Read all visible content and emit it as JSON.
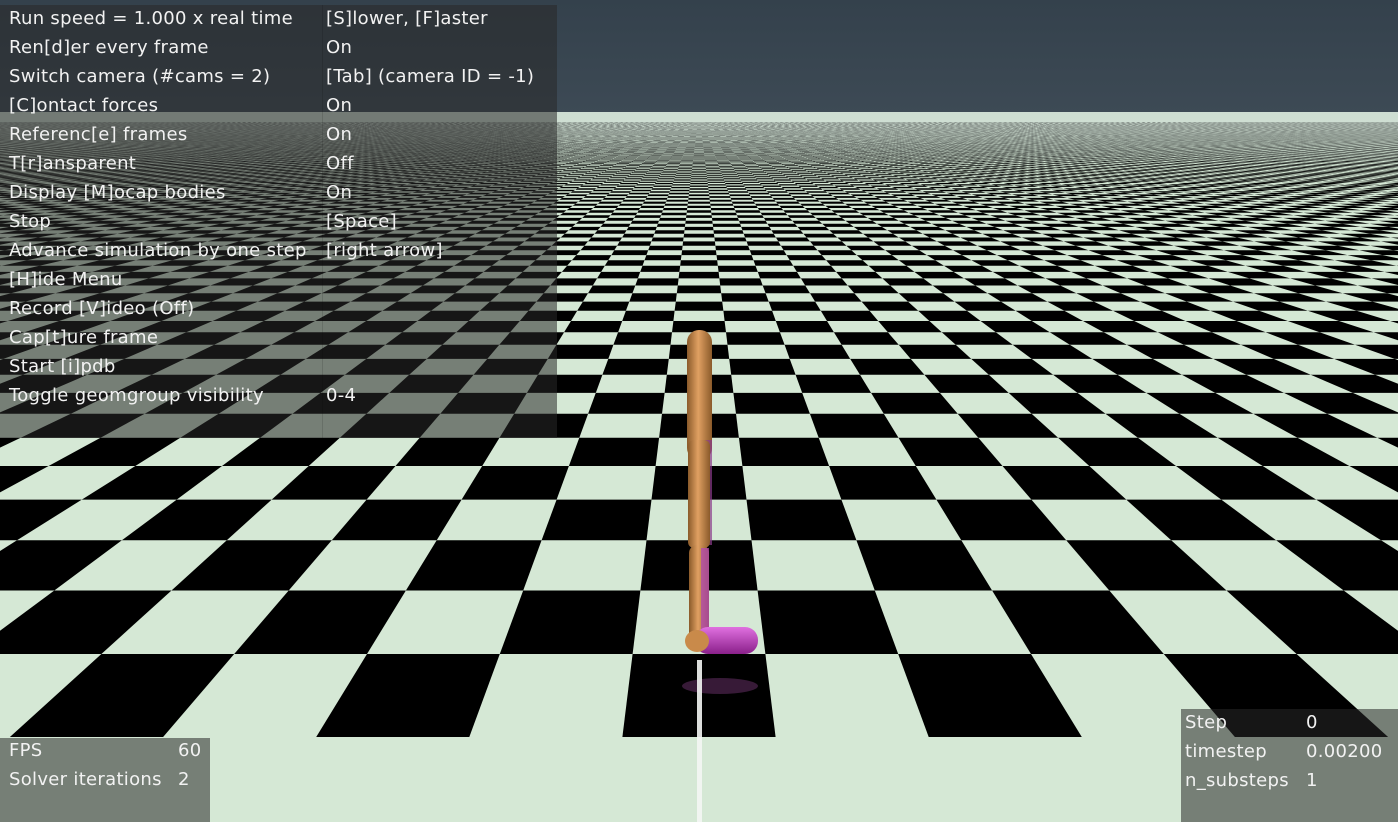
{
  "menu": [
    {
      "label": "Run speed = 1.000 x real time",
      "value": "[S]lower, [F]aster"
    },
    {
      "label": "Ren[d]er every frame",
      "value": "On"
    },
    {
      "label": "Switch camera (#cams = 2)",
      "value": "[Tab] (camera ID = -1)"
    },
    {
      "label": "[C]ontact forces",
      "value": "On"
    },
    {
      "label": "Referenc[e] frames",
      "value": "On"
    },
    {
      "label": "T[r]ansparent",
      "value": "Off"
    },
    {
      "label": "Display [M]ocap bodies",
      "value": "On"
    },
    {
      "label": "Stop",
      "value": "[Space]"
    },
    {
      "label": "Advance simulation by one step",
      "value": "[right arrow]"
    },
    {
      "label": "[H]ide Menu",
      "value": ""
    },
    {
      "label": "Record [V]ideo (Off)",
      "value": ""
    },
    {
      "label": "Cap[t]ure frame",
      "value": ""
    },
    {
      "label": "Start [i]pdb",
      "value": ""
    },
    {
      "label": "Toggle geomgroup visibility",
      "value": "0-4"
    }
  ],
  "stats_left": [
    {
      "label": "FPS",
      "value": "60"
    },
    {
      "label": "Solver iterations",
      "value": "2"
    }
  ],
  "stats_right": [
    {
      "label": "Step",
      "value": "0"
    },
    {
      "label": "timestep",
      "value": "0.00200"
    },
    {
      "label": "n_substeps",
      "value": "1"
    }
  ],
  "colors": {
    "sky": "#34414c",
    "checker_light": "#d5e8d5",
    "checker_dark": "#000000",
    "body_orange": "#c98a4a",
    "body_magenta": "#c040c0"
  }
}
